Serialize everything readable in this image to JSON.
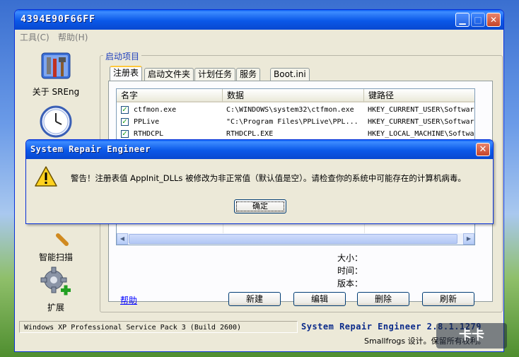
{
  "window": {
    "title": "4394E90F66FF"
  },
  "menu": [
    {
      "label": "工具(C)"
    },
    {
      "label": "帮助(H)"
    }
  ],
  "nav": [
    {
      "label": "关于 SREng",
      "icon": "tools-icon"
    },
    {
      "label": "",
      "icon": "clock-icon"
    },
    {
      "label": "智能扫描",
      "icon": "magnifier-icon"
    },
    {
      "label": "扩展",
      "icon": "gear-plus-icon"
    }
  ],
  "group": {
    "label": "启动项目"
  },
  "tabs": [
    {
      "label": "注册表",
      "selected": true
    },
    {
      "label": "启动文件夹"
    },
    {
      "label": "计划任务"
    },
    {
      "label": "服务"
    },
    {
      "label": "Boot.ini"
    }
  ],
  "list": {
    "columns": [
      "名字",
      "数据",
      "键路径"
    ],
    "rows": [
      {
        "checked": true,
        "name": "ctfmon.exe",
        "data": "C:\\WINDOWS\\system32\\ctfmon.exe",
        "path": "HKEY_CURRENT_USER\\Softwar"
      },
      {
        "checked": true,
        "name": "PPLive",
        "data": "\"C:\\Program Files\\PPLive\\PPL...",
        "path": "HKEY_CURRENT_USER\\Softwar"
      },
      {
        "checked": true,
        "name": "RTHDCPL",
        "data": "RTHDCPL.EXE",
        "path": "HKEY_LOCAL_MACHINE\\Softwa"
      }
    ]
  },
  "details": {
    "size_label": "大小：",
    "time_label": "时间：",
    "version_label": "版本："
  },
  "help_link": "帮助",
  "buttons": {
    "new": "新建",
    "edit": "编辑",
    "delete": "删除",
    "refresh": "刷新"
  },
  "status": {
    "os": "Windows XP Professional Service Pack 3 (Build 2600)",
    "product": "System Repair Engineer 2.8.1.1279",
    "copyright": "Smallfrogs 设计。保留所有权利。"
  },
  "dialog": {
    "title": "System Repair Engineer",
    "message": "警告！注册表值 AppInit_DLLs 被修改为非正常值（默认值是空）。请检查你的系统中可能存在的计算机病毒。",
    "ok": "确定"
  },
  "watermark": "卡卡"
}
